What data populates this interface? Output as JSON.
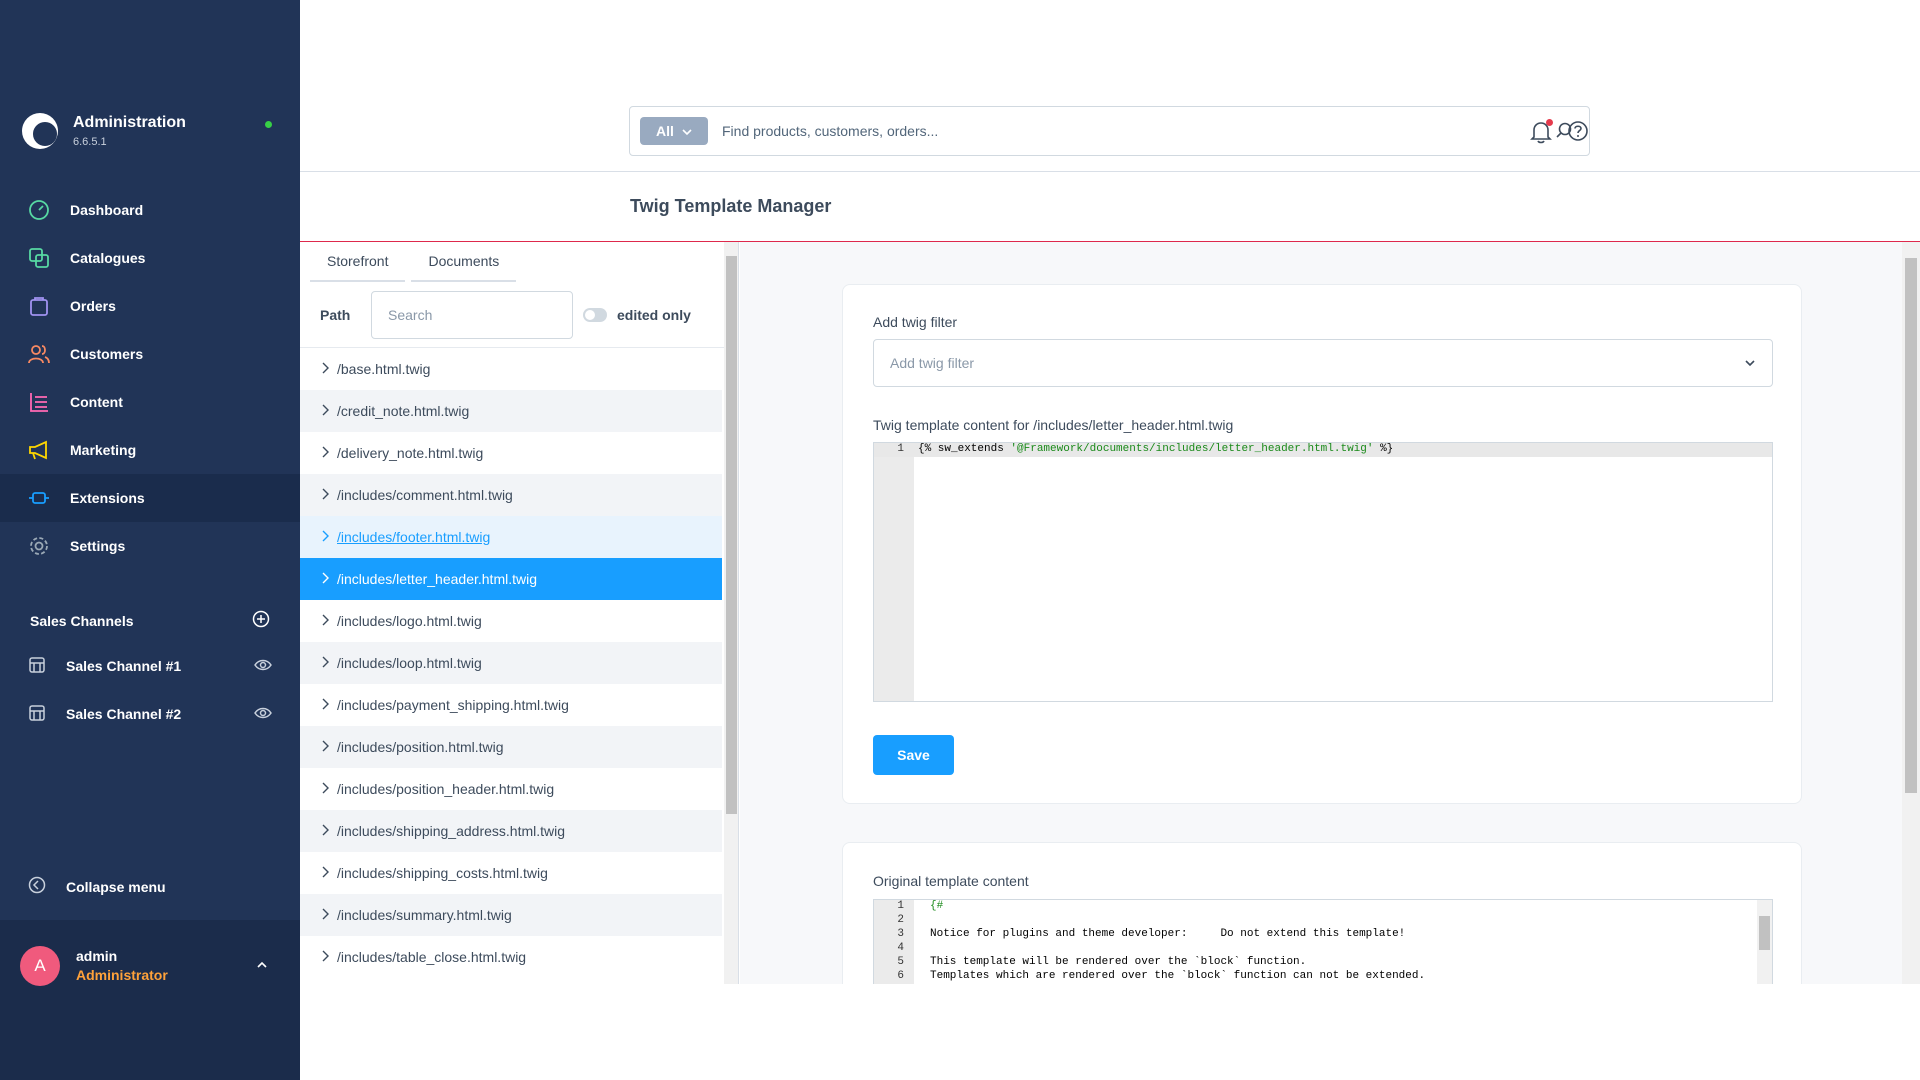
{
  "app": {
    "title": "Administration",
    "version": "6.6.5.1"
  },
  "nav": [
    {
      "label": "Dashboard",
      "icon": "dashboard-icon",
      "color": "#57d9a3"
    },
    {
      "label": "Catalogues",
      "icon": "catalogue-icon",
      "color": "#57d9a3"
    },
    {
      "label": "Orders",
      "icon": "orders-icon",
      "color": "#a092f0"
    },
    {
      "label": "Customers",
      "icon": "customers-icon",
      "color": "#f88962"
    },
    {
      "label": "Content",
      "icon": "content-icon",
      "color": "#ff68b4"
    },
    {
      "label": "Marketing",
      "icon": "marketing-icon",
      "color": "#ffd700"
    },
    {
      "label": "Extensions",
      "icon": "extensions-icon",
      "color": "#189eff",
      "active": true
    },
    {
      "label": "Settings",
      "icon": "settings-icon",
      "color": "#9aa8b5"
    }
  ],
  "sales_channels": {
    "title": "Sales Channels",
    "items": [
      {
        "label": "Sales Channel #1"
      },
      {
        "label": "Sales Channel #2"
      }
    ]
  },
  "collapse_label": "Collapse menu",
  "user": {
    "initial": "A",
    "name": "admin",
    "role": "Administrator"
  },
  "search": {
    "type": "All",
    "placeholder": "Find products, customers, orders..."
  },
  "page_title": "Twig Template Manager",
  "tabs": [
    {
      "label": "Storefront"
    },
    {
      "label": "Documents"
    }
  ],
  "filter": {
    "path_label": "Path",
    "search_placeholder": "Search",
    "toggle_label": "edited only"
  },
  "files": [
    "/base.html.twig",
    "/credit_note.html.twig",
    "/delivery_note.html.twig",
    "/includes/comment.html.twig",
    "/includes/footer.html.twig",
    "/includes/letter_header.html.twig",
    "/includes/logo.html.twig",
    "/includes/loop.html.twig",
    "/includes/payment_shipping.html.twig",
    "/includes/position.html.twig",
    "/includes/position_header.html.twig",
    "/includes/shipping_address.html.twig",
    "/includes/shipping_costs.html.twig",
    "/includes/summary.html.twig",
    "/includes/table_close.html.twig"
  ],
  "editor": {
    "filter_label": "Add twig filter",
    "filter_placeholder": "Add twig filter",
    "content_label": "Twig template content for /includes/letter_header.html.twig",
    "line1_pre": "{% sw_extends ",
    "line1_str": "'@Framework/documents/includes/letter_header.html.twig'",
    "line1_post": " %}",
    "save_label": "Save"
  },
  "original": {
    "label": "Original template content",
    "lines": [
      "{#",
      "",
      "Notice for plugins and theme developer:     Do not extend this template!",
      "",
      "This template will be rendered over the `block` function.",
      "Templates which are rendered over the `block` function can not be extended."
    ]
  }
}
